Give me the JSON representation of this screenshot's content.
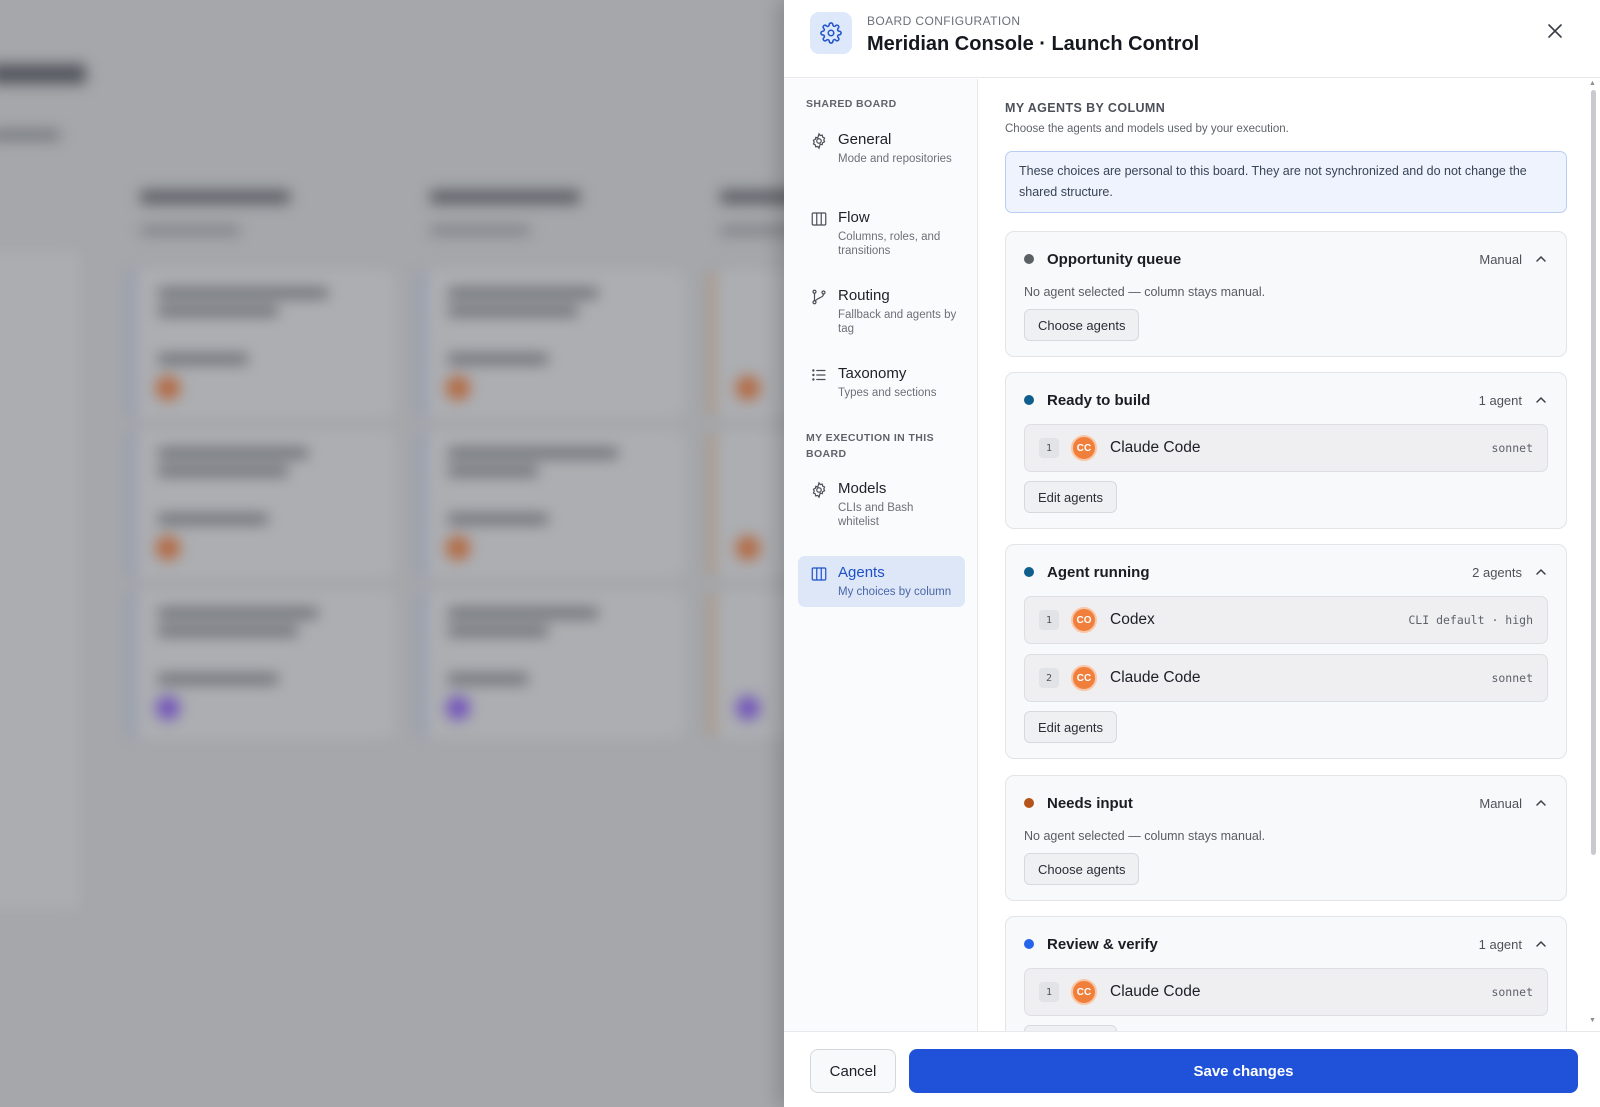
{
  "header": {
    "kicker": "BOARD CONFIGURATION",
    "title": "Meridian Console · Launch Control"
  },
  "sidebar": {
    "section_shared": "SHARED BOARD",
    "section_execution": "MY EXECUTION IN THIS BOARD",
    "items": [
      {
        "label": "General",
        "desc": "Mode and repositories",
        "icon": "gear-icon"
      },
      {
        "label": "Flow",
        "desc": "Columns, roles, and transitions",
        "icon": "columns-icon"
      },
      {
        "label": "Routing",
        "desc": "Fallback and agents by tag",
        "icon": "branch-icon"
      },
      {
        "label": "Taxonomy",
        "desc": "Types and sections",
        "icon": "list-icon"
      },
      {
        "label": "Models",
        "desc": "CLIs and Bash whitelist",
        "icon": "gear-icon"
      },
      {
        "label": "Agents",
        "desc": "My choices by column",
        "icon": "columns-icon",
        "active": true
      }
    ]
  },
  "content": {
    "title": "MY AGENTS BY COLUMN",
    "subtitle": "Choose the agents and models used by your execution.",
    "notice": "These choices are personal to this board. They are not synchronized and do not change the shared structure.",
    "empty_text": "No agent selected — column stays manual.",
    "choose_label": "Choose agents",
    "edit_label": "Edit agents",
    "columns": [
      {
        "name": "Opportunity queue",
        "status": "Manual",
        "dot_color": "#5b5f66",
        "agents": []
      },
      {
        "name": "Ready to build",
        "status": "1 agent",
        "dot_color": "#0f5e8c",
        "agents": [
          {
            "index": "1",
            "badge": "CC",
            "name": "Claude Code",
            "model": "sonnet"
          }
        ]
      },
      {
        "name": "Agent running",
        "status": "2 agents",
        "dot_color": "#0f5e8c",
        "agents": [
          {
            "index": "1",
            "badge": "CO",
            "name": "Codex",
            "model": "CLI default · high"
          },
          {
            "index": "2",
            "badge": "CC",
            "name": "Claude Code",
            "model": "sonnet"
          }
        ]
      },
      {
        "name": "Needs input",
        "status": "Manual",
        "dot_color": "#b4531a",
        "agents": []
      },
      {
        "name": "Review & verify",
        "status": "1 agent",
        "dot_color": "#2563eb",
        "agents": [
          {
            "index": "1",
            "badge": "CC",
            "name": "Claude Code",
            "model": "sonnet"
          }
        ]
      }
    ]
  },
  "footer": {
    "cancel_label": "Cancel",
    "save_label": "Save changes"
  },
  "colors": {
    "primary": "#1f52d9",
    "agent_badge": "#f07f3c",
    "active_nav": "#dde7f8"
  }
}
